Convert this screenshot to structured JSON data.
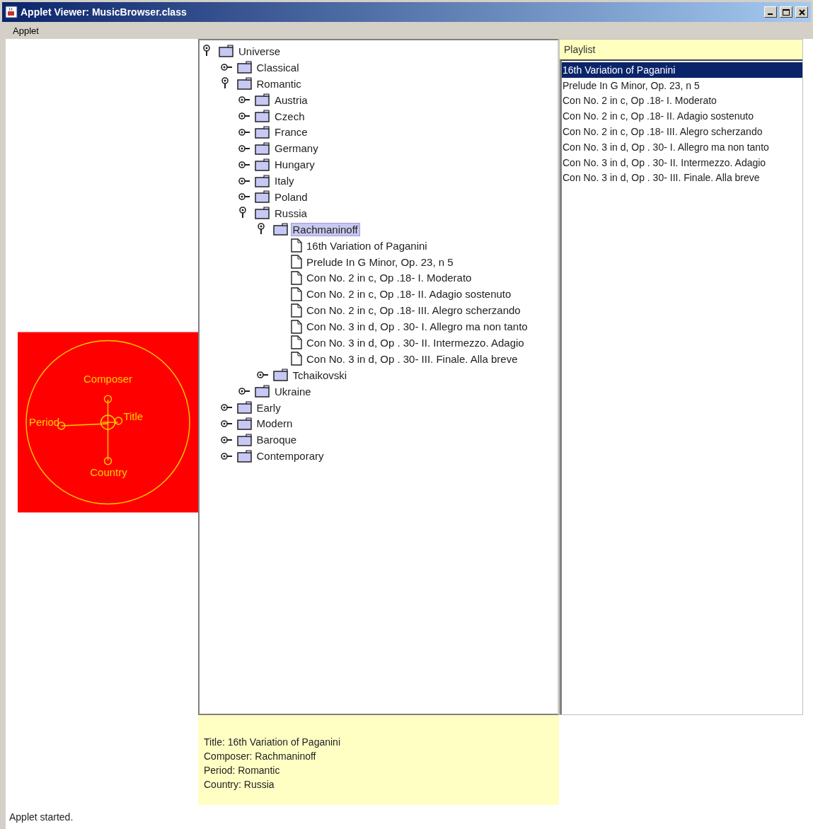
{
  "window": {
    "title": "Applet Viewer: MusicBrowser.class"
  },
  "menu": [
    "Applet"
  ],
  "diagram": {
    "labels": [
      "Composer",
      "Period",
      "Title",
      "Country"
    ]
  },
  "tree": [
    {
      "label": "Universe",
      "kind": "folder",
      "expanded": true,
      "selected": false,
      "children": [
        {
          "label": "Classical",
          "kind": "folder",
          "expanded": false,
          "selected": false
        },
        {
          "label": "Romantic",
          "kind": "folder",
          "expanded": true,
          "selected": false,
          "children": [
            {
              "label": "Austria",
              "kind": "folder",
              "expanded": false,
              "selected": false
            },
            {
              "label": "Czech",
              "kind": "folder",
              "expanded": false,
              "selected": false
            },
            {
              "label": "France",
              "kind": "folder",
              "expanded": false,
              "selected": false
            },
            {
              "label": "Germany",
              "kind": "folder",
              "expanded": false,
              "selected": false
            },
            {
              "label": "Hungary",
              "kind": "folder",
              "expanded": false,
              "selected": false
            },
            {
              "label": "Italy",
              "kind": "folder",
              "expanded": false,
              "selected": false
            },
            {
              "label": "Poland",
              "kind": "folder",
              "expanded": false,
              "selected": false
            },
            {
              "label": "Russia",
              "kind": "folder",
              "expanded": true,
              "selected": false,
              "children": [
                {
                  "label": "Rachmaninoff",
                  "kind": "folder",
                  "expanded": true,
                  "selected": true,
                  "children": [
                    {
                      "label": "16th Variation of Paganini",
                      "kind": "leaf",
                      "selected": false
                    },
                    {
                      "label": "Prelude In G Minor, Op. 23, n 5",
                      "kind": "leaf",
                      "selected": false
                    },
                    {
                      "label": "Con No. 2 in c, Op .18- I. Moderato",
                      "kind": "leaf",
                      "selected": false
                    },
                    {
                      "label": "Con No. 2 in c, Op .18- II. Adagio sostenuto",
                      "kind": "leaf",
                      "selected": false
                    },
                    {
                      "label": "Con No. 2 in c, Op .18- III. Alegro scherzando",
                      "kind": "leaf",
                      "selected": false
                    },
                    {
                      "label": "Con No. 3 in d, Op . 30- I. Allegro ma non tanto",
                      "kind": "leaf",
                      "selected": false
                    },
                    {
                      "label": "Con No. 3 in d, Op . 30- II. Intermezzo. Adagio",
                      "kind": "leaf",
                      "selected": false
                    },
                    {
                      "label": "Con No. 3 in d, Op . 30- III. Finale. Alla breve",
                      "kind": "leaf",
                      "selected": false
                    }
                  ]
                },
                {
                  "label": "Tchaikovski",
                  "kind": "folder",
                  "expanded": false,
                  "selected": false
                }
              ]
            },
            {
              "label": "Ukraine",
              "kind": "folder",
              "expanded": false,
              "selected": false
            }
          ]
        },
        {
          "label": "Early",
          "kind": "folder",
          "expanded": false,
          "selected": false
        },
        {
          "label": "Modern",
          "kind": "folder",
          "expanded": false,
          "selected": false
        },
        {
          "label": "Baroque",
          "kind": "folder",
          "expanded": false,
          "selected": false
        },
        {
          "label": "Contemporary",
          "kind": "folder",
          "expanded": false,
          "selected": false
        }
      ]
    }
  ],
  "playlist": {
    "title": "Playlist",
    "items": [
      {
        "label": "16th Variation of Paganini",
        "selected": true
      },
      {
        "label": "Prelude In G Minor, Op. 23, n 5",
        "selected": false
      },
      {
        "label": "Con No. 2 in c, Op .18- I. Moderato",
        "selected": false
      },
      {
        "label": "Con No. 2 in c, Op .18- II. Adagio sostenuto",
        "selected": false
      },
      {
        "label": "Con No. 2 in c, Op .18- III. Alegro scherzando",
        "selected": false
      },
      {
        "label": "Con No. 3 in d, Op . 30- I. Allegro ma non tanto",
        "selected": false
      },
      {
        "label": "Con No. 3 in d, Op . 30- II. Intermezzo. Adagio",
        "selected": false
      },
      {
        "label": "Con No. 3 in d, Op . 30- III. Finale. Alla breve",
        "selected": false
      }
    ]
  },
  "details": [
    "Title: 16th Variation of Paganini",
    "Composer: Rachmaninoff",
    "Period: Romantic",
    "Country: Russia"
  ],
  "status_bar": "Applet started."
}
